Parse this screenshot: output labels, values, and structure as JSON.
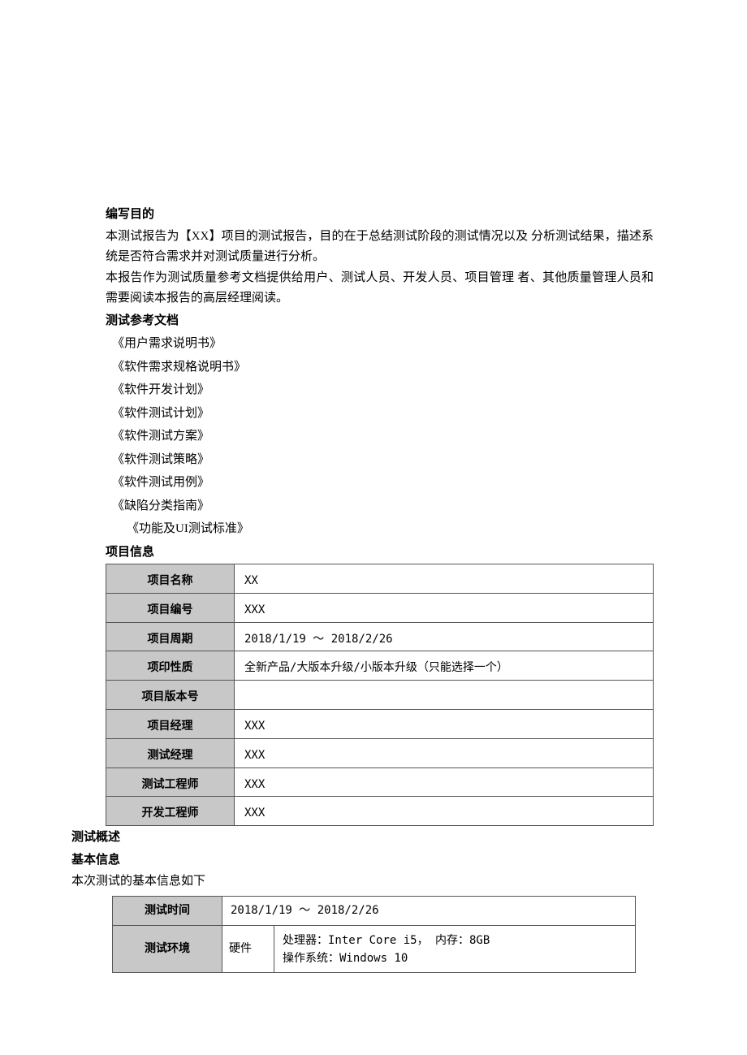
{
  "headings": {
    "purpose": "编写目的",
    "refDocs": "测试参考文档",
    "projectInfo": "项目信息",
    "testOverview": "测试概述",
    "basicInfo": "基本信息"
  },
  "purpose": {
    "p1": "本测试报告为【XX】项目的测试报告，目的在于总结测试阶段的测试情况以及 分析测试结果，描述系统是否符合需求并对测试质量进行分析。",
    "p2": "本报告作为测试质量参考文档提供给用户、测试人员、开发人员、项目管理 者、其他质量管理人员和需要阅读本报告的高层经理阅读。"
  },
  "refDocs": [
    "《用户需求说明书》",
    "《软件需求规格说明书》",
    "《软件开发计划》",
    "《软件测试计划》",
    "《软件测试方案》",
    "《软件测试策略》",
    "《软件测试用例》",
    "《缺陷分类指南》",
    "《功能及UI测试标准》"
  ],
  "projectInfo": {
    "rows": [
      {
        "label": "项目名称",
        "value": "XX"
      },
      {
        "label": "项目编号",
        "value": "XXX"
      },
      {
        "label": "项目周期",
        "value": "2018/1/19 ～ 2018/2/26"
      },
      {
        "label": "项印性质",
        "value": "全新产品/大版本升级/小版本升级（只能选择一个）"
      },
      {
        "label": "项目版本号",
        "value": ""
      },
      {
        "label": "项目经理",
        "value": "XXX"
      },
      {
        "label": "测试经理",
        "value": "XXX"
      },
      {
        "label": "测试工程师",
        "value": "XXX"
      },
      {
        "label": "开发工程师",
        "value": "XXX"
      }
    ]
  },
  "basicInfo": {
    "intro": "本次测试的基本信息如下",
    "testTime": {
      "label": "测试时间",
      "value": "2018/1/19 ～ 2018/2/26"
    },
    "testEnv": {
      "label": "测试环境",
      "hardware": {
        "label": "硬件",
        "spec1": "处理器：Inter Core i5，  内存：8GB",
        "spec2": "操作系统：Windows 10"
      }
    }
  }
}
